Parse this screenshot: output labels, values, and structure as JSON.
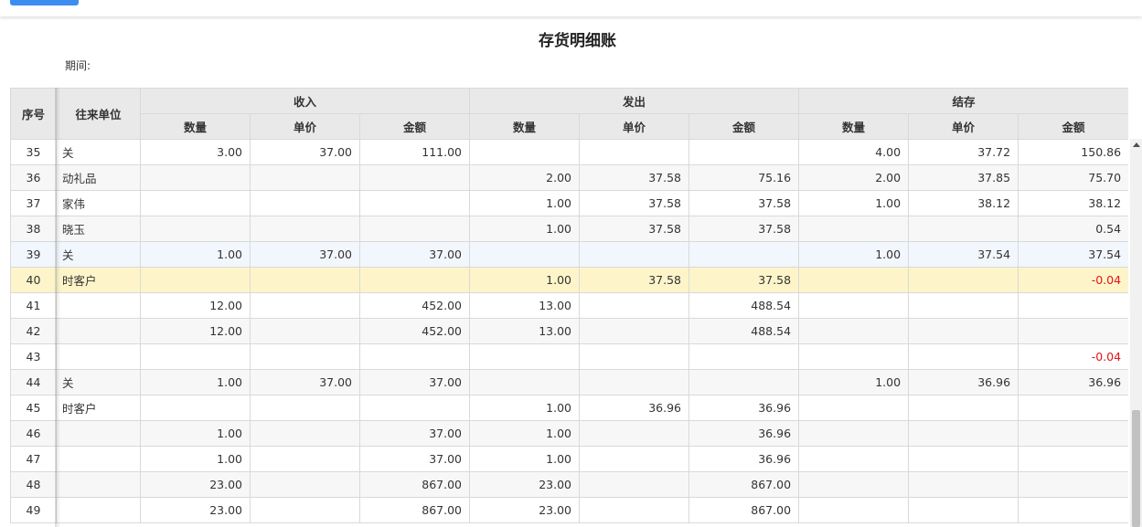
{
  "report": {
    "title": "存货明细账",
    "period_label": "期间:"
  },
  "columns": {
    "seq": "序号",
    "unit": "往来单位",
    "groups": [
      "收入",
      "发出",
      "结存"
    ],
    "sub": [
      "数量",
      "单价",
      "金额"
    ]
  },
  "rows": [
    {
      "seq": "35",
      "unit": "关",
      "in_qty": "3.00",
      "in_price": "37.00",
      "in_amt": "111.00",
      "out_qty": "",
      "out_price": "",
      "out_amt": "",
      "bal_qty": "4.00",
      "bal_price": "37.72",
      "bal_amt": "150.86"
    },
    {
      "seq": "36",
      "unit": "动礼品",
      "in_qty": "",
      "in_price": "",
      "in_amt": "",
      "out_qty": "2.00",
      "out_price": "37.58",
      "out_amt": "75.16",
      "bal_qty": "2.00",
      "bal_price": "37.85",
      "bal_amt": "75.70"
    },
    {
      "seq": "37",
      "unit": "家伟",
      "in_qty": "",
      "in_price": "",
      "in_amt": "",
      "out_qty": "1.00",
      "out_price": "37.58",
      "out_amt": "37.58",
      "bal_qty": "1.00",
      "bal_price": "38.12",
      "bal_amt": "38.12"
    },
    {
      "seq": "38",
      "unit": "晓玉",
      "in_qty": "",
      "in_price": "",
      "in_amt": "",
      "out_qty": "1.00",
      "out_price": "37.58",
      "out_amt": "37.58",
      "bal_qty": "",
      "bal_price": "",
      "bal_amt": "0.54"
    },
    {
      "seq": "39",
      "unit": "关",
      "in_qty": "1.00",
      "in_price": "37.00",
      "in_amt": "37.00",
      "out_qty": "",
      "out_price": "",
      "out_amt": "",
      "bal_qty": "1.00",
      "bal_price": "37.54",
      "bal_amt": "37.54"
    },
    {
      "seq": "40",
      "unit": "时客户",
      "in_qty": "",
      "in_price": "",
      "in_amt": "",
      "out_qty": "1.00",
      "out_price": "37.58",
      "out_amt": "37.58",
      "bal_qty": "",
      "bal_price": "",
      "bal_amt": "-0.04"
    },
    {
      "seq": "41",
      "unit": "",
      "in_qty": "12.00",
      "in_price": "",
      "in_amt": "452.00",
      "out_qty": "13.00",
      "out_price": "",
      "out_amt": "488.54",
      "bal_qty": "",
      "bal_price": "",
      "bal_amt": ""
    },
    {
      "seq": "42",
      "unit": "",
      "in_qty": "12.00",
      "in_price": "",
      "in_amt": "452.00",
      "out_qty": "13.00",
      "out_price": "",
      "out_amt": "488.54",
      "bal_qty": "",
      "bal_price": "",
      "bal_amt": ""
    },
    {
      "seq": "43",
      "unit": "",
      "in_qty": "",
      "in_price": "",
      "in_amt": "",
      "out_qty": "",
      "out_price": "",
      "out_amt": "",
      "bal_qty": "",
      "bal_price": "",
      "bal_amt": "-0.04"
    },
    {
      "seq": "44",
      "unit": "关",
      "in_qty": "1.00",
      "in_price": "37.00",
      "in_amt": "37.00",
      "out_qty": "",
      "out_price": "",
      "out_amt": "",
      "bal_qty": "1.00",
      "bal_price": "36.96",
      "bal_amt": "36.96"
    },
    {
      "seq": "45",
      "unit": "时客户",
      "in_qty": "",
      "in_price": "",
      "in_amt": "",
      "out_qty": "1.00",
      "out_price": "36.96",
      "out_amt": "36.96",
      "bal_qty": "",
      "bal_price": "",
      "bal_amt": ""
    },
    {
      "seq": "46",
      "unit": "",
      "in_qty": "1.00",
      "in_price": "",
      "in_amt": "37.00",
      "out_qty": "1.00",
      "out_price": "",
      "out_amt": "36.96",
      "bal_qty": "",
      "bal_price": "",
      "bal_amt": ""
    },
    {
      "seq": "47",
      "unit": "",
      "in_qty": "1.00",
      "in_price": "",
      "in_amt": "37.00",
      "out_qty": "1.00",
      "out_price": "",
      "out_amt": "36.96",
      "bal_qty": "",
      "bal_price": "",
      "bal_amt": ""
    },
    {
      "seq": "48",
      "unit": "",
      "in_qty": "23.00",
      "in_price": "",
      "in_amt": "867.00",
      "out_qty": "23.00",
      "out_price": "",
      "out_amt": "867.00",
      "bal_qty": "",
      "bal_price": "",
      "bal_amt": ""
    },
    {
      "seq": "49",
      "unit": "",
      "in_qty": "23.00",
      "in_price": "",
      "in_amt": "867.00",
      "out_qty": "23.00",
      "out_price": "",
      "out_amt": "867.00",
      "bal_qty": "",
      "bal_price": "",
      "bal_amt": ""
    }
  ],
  "state": {
    "hover_row": "39",
    "selected_row": "40"
  },
  "colors": {
    "accent": "#3d8cf0",
    "negative": "#e5121b",
    "selected_row": "#fdf5c9",
    "header_bg": "#e9e9e9"
  }
}
